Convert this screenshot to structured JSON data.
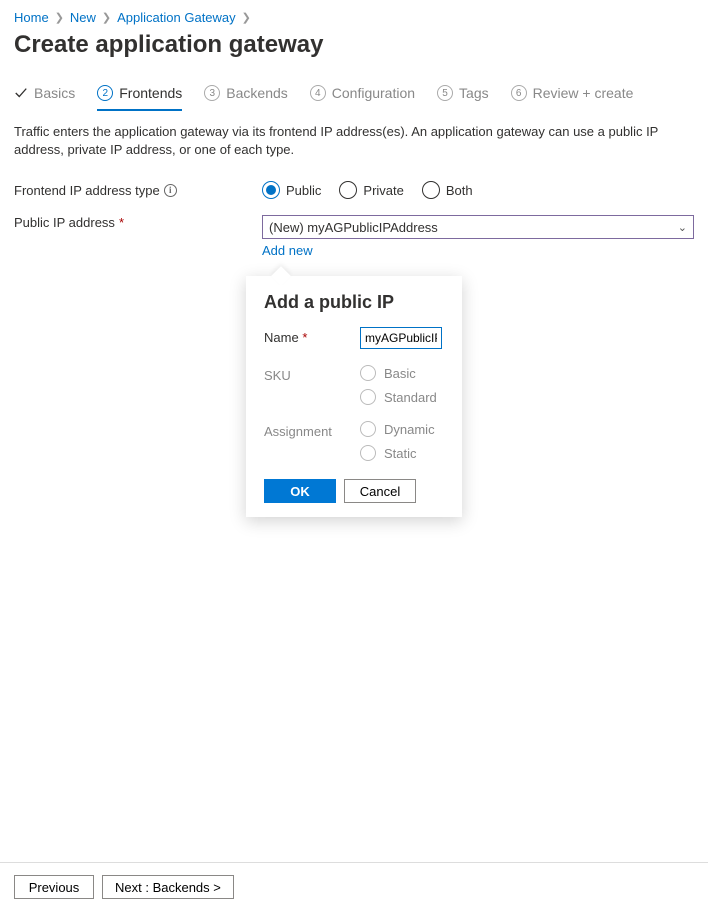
{
  "breadcrumbs": {
    "items": [
      {
        "label": "Home"
      },
      {
        "label": "New"
      },
      {
        "label": "Application Gateway"
      }
    ]
  },
  "page_title": "Create application gateway",
  "tabs": [
    {
      "num": "",
      "label": "Basics",
      "done": true
    },
    {
      "num": "2",
      "label": "Frontends",
      "active": true
    },
    {
      "num": "3",
      "label": "Backends"
    },
    {
      "num": "4",
      "label": "Configuration"
    },
    {
      "num": "5",
      "label": "Tags"
    },
    {
      "num": "6",
      "label": "Review + create"
    }
  ],
  "description": "Traffic enters the application gateway via its frontend IP address(es). An application gateway can use a public IP address, private IP address, or one of each type.",
  "frontend_ip_type": {
    "label": "Frontend IP address type",
    "options": {
      "public": "Public",
      "private": "Private",
      "both": "Both"
    }
  },
  "public_ip": {
    "label": "Public IP address",
    "value": "(New) myAGPublicIPAddress",
    "add_new": "Add new"
  },
  "popover": {
    "title": "Add a public IP",
    "name_label": "Name",
    "name_value": "myAGPublicIPAddress",
    "sku_label": "SKU",
    "sku_options": {
      "basic": "Basic",
      "standard": "Standard"
    },
    "assignment_label": "Assignment",
    "assignment_options": {
      "dynamic": "Dynamic",
      "static": "Static"
    },
    "ok": "OK",
    "cancel": "Cancel"
  },
  "footer": {
    "previous": "Previous",
    "next": "Next : Backends >"
  }
}
